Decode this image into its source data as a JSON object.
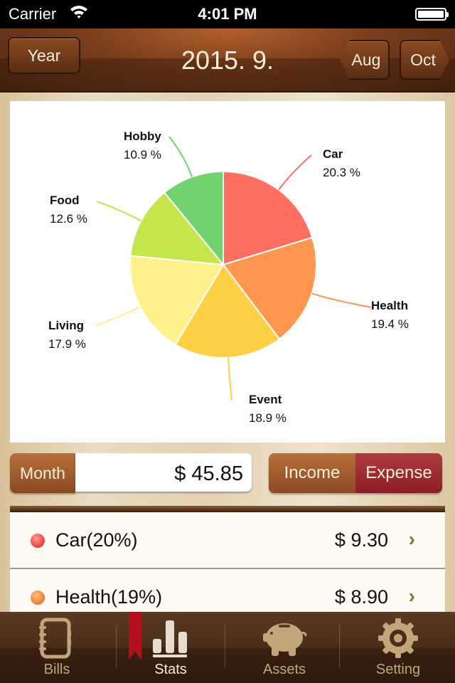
{
  "status_bar": {
    "carrier": "Carrier",
    "time": "4:01 PM",
    "wifi_icon": "wifi-icon",
    "battery_icon": "battery-icon"
  },
  "nav": {
    "year_button": "Year",
    "title": "2015. 9.",
    "prev_button": "Aug",
    "next_button": "Oct"
  },
  "chart_data": {
    "type": "pie",
    "title": "",
    "slices": [
      {
        "label": "Car",
        "value": 20.3,
        "value_text": "20.3 %",
        "color": "#ff6f61"
      },
      {
        "label": "Health",
        "value": 19.4,
        "value_text": "19.4 %",
        "color": "#ff9650"
      },
      {
        "label": "Event",
        "value": 18.9,
        "value_text": "18.9 %",
        "color": "#ffd045"
      },
      {
        "label": "Living",
        "value": 17.9,
        "value_text": "17.9 %",
        "color": "#fff08c"
      },
      {
        "label": "Food",
        "value": 12.6,
        "value_text": "12.6 %",
        "color": "#c3e64a"
      },
      {
        "label": "Hobby",
        "value": 10.9,
        "value_text": "10.9 %",
        "color": "#72d26e"
      }
    ],
    "start": "12 o'clock",
    "direction": "clockwise"
  },
  "summary": {
    "period_label": "Month",
    "total": "$ 45.85",
    "type_options": [
      "Income",
      "Expense"
    ],
    "selected_type": "Expense"
  },
  "list": {
    "items": [
      {
        "label": "Car(20%)",
        "amount": "$ 9.30",
        "color": "#f04a45"
      },
      {
        "label": "Health(19%)",
        "amount": "$ 8.90",
        "color": "#f5823a"
      }
    ]
  },
  "tabbar": {
    "items": [
      {
        "label": "Bills",
        "icon": "notebook-icon"
      },
      {
        "label": "Stats",
        "icon": "bar-chart-icon",
        "active": true
      },
      {
        "label": "Assets",
        "icon": "piggy-bank-icon"
      },
      {
        "label": "Setting",
        "icon": "gear-icon"
      }
    ]
  }
}
